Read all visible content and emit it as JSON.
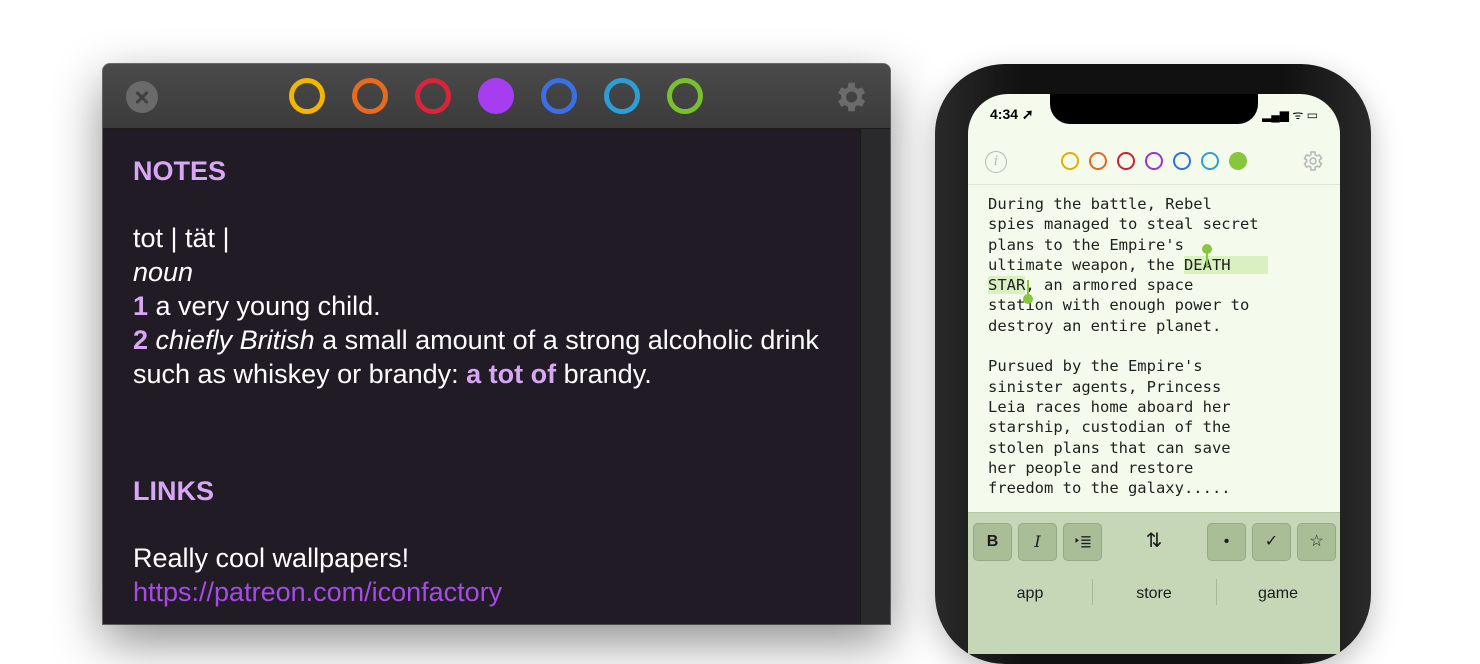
{
  "mac": {
    "colors": [
      "#f2b500",
      "#e66a1f",
      "#d9253a",
      "#a63df0",
      "#3a6fe6",
      "#2c9ed6",
      "#78c02d"
    ],
    "selected_color_index": 3,
    "notes_heading": "NOTES",
    "entry_word": "tot | tät |",
    "part_of_speech": "noun",
    "def1_num": "1",
    "def1_text": " a very young child.",
    "def2_num": "2",
    "def2_label": "chiefly British",
    "def2_text": " a small amount of a strong alcoholic drink such as whiskey or brandy: ",
    "def2_example": "a tot of",
    "def2_tail": " brandy.",
    "links_heading": "LINKS",
    "links_text": "Really cool wallpapers!",
    "links_url": "https://patreon.com/iconfactory"
  },
  "phone": {
    "time": "4:34",
    "colors": [
      "#e0b000",
      "#e06a20",
      "#cc2035",
      "#9933dd",
      "#2e6fe6",
      "#2c9ed6",
      "#88c63c"
    ],
    "selected_color_index": 6,
    "text_before": "During the battle, Rebel\nspies managed to steal secret\nplans to the Empire's\nultimate weapon, the ",
    "text_selected_1": "DEATH    ",
    "text_selected_2": "STAR",
    "text_after": ", an armored space\nstation with enough power to\ndestroy an entire planet.\n\nPursued by the Empire's\nsinister agents, Princess\nLeia races home aboard her\nstarship, custodian of the\nstolen plans that can save\nher people and restore\nfreedom to the galaxy.....",
    "keyboard": {
      "bold": "B",
      "italic": "I",
      "bullet": "•",
      "check": "✓",
      "star": "☆",
      "sort": "⇅",
      "suggestions": [
        "app",
        "store",
        "game"
      ]
    }
  }
}
